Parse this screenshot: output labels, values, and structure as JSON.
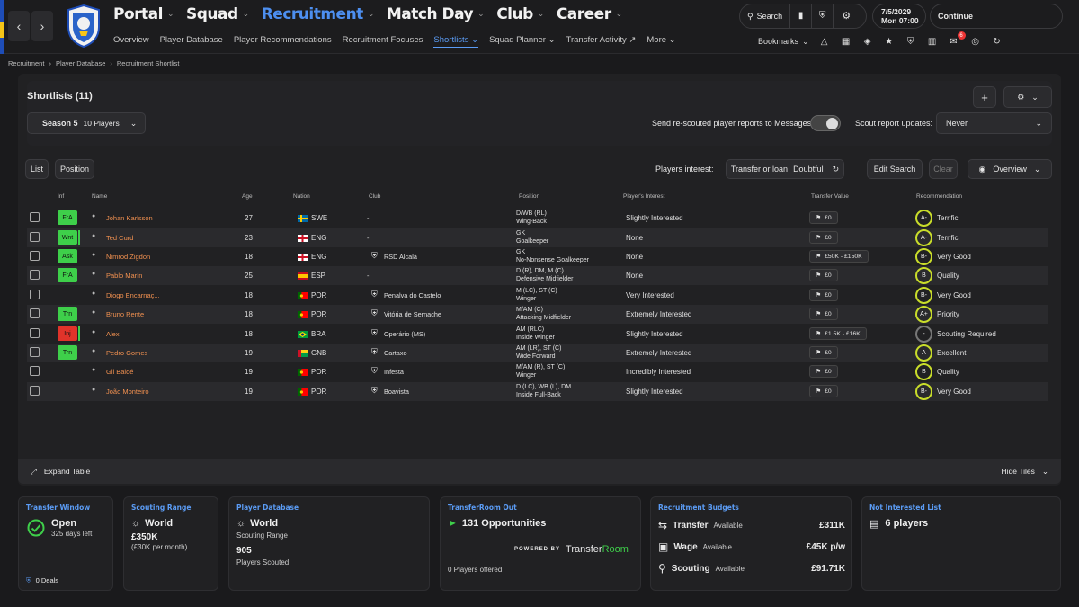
{
  "topnav": {
    "main": [
      {
        "label": "Portal"
      },
      {
        "label": "Squad"
      },
      {
        "label": "Recruitment",
        "active": true
      },
      {
        "label": "Match Day"
      },
      {
        "label": "Club"
      },
      {
        "label": "Career"
      }
    ],
    "sub": [
      "Overview",
      "Player Database",
      "Player Recommendations",
      "Recruitment Focuses",
      "Shortlists",
      "Squad Planner",
      "Transfer Activity",
      "More"
    ],
    "search_label": "Search",
    "date_line1": "7/5/2029",
    "date_line2": "Mon  07:00",
    "continue_label": "Continue",
    "bookmarks_label": "Bookmarks",
    "notif_count": "6"
  },
  "breadcrumb": [
    "Recruitment",
    "Player Database",
    "Recruitment Shortlist"
  ],
  "shortlists": {
    "title": "Shortlists (11)",
    "season_label": "Season 5",
    "season_count": "10 Players",
    "send_reports_label": "Send re-scouted player reports to Messages",
    "scout_updates_label": "Scout report updates:",
    "scout_updates_value": "Never"
  },
  "filters": {
    "list_label": "List",
    "position_label": "Position",
    "interest_label": "Players interest:",
    "interest_value": "Transfer or loan",
    "interest_sub": "Doubtful",
    "edit_search": "Edit Search",
    "clear": "Clear",
    "view": "Overview"
  },
  "columns": [
    "Inf",
    "Name",
    "Age",
    "Nation",
    "Club",
    "Position",
    "Player's Interest",
    "Transfer Value",
    "Recommendation"
  ],
  "rows": [
    {
      "inf": "FrA",
      "inf_color": "#3ecf4a",
      "name": "Johan Karlsson",
      "age": "27",
      "nation": "SWE",
      "flag": "swe",
      "club": "-",
      "pos1": "D/WB (RL)",
      "pos2": "Wing-Back",
      "interest": "Slightly Interested",
      "value": "£0",
      "rec": "A-",
      "rec_text": "Terrific"
    },
    {
      "inf": "Wnt",
      "inf_color": "#3ecf4a",
      "edge": "#3ecf4a",
      "name": "Ted Curd",
      "age": "23",
      "nation": "ENG",
      "flag": "eng",
      "club": "-",
      "pos1": "GK",
      "pos2": "Goalkeeper",
      "interest": "None",
      "value": "£0",
      "rec": "A-",
      "rec_text": "Terrific"
    },
    {
      "inf": "Ask",
      "inf_color": "#3ecf4a",
      "name": "Nimrod Zigdon",
      "age": "18",
      "nation": "ENG",
      "flag": "eng",
      "club": "RSD Alcalá",
      "pos1": "GK",
      "pos2": "No-Nonsense Goalkeeper",
      "interest": "None",
      "value": "£50K - £150K",
      "rec": "B-",
      "rec_text": "Very Good"
    },
    {
      "inf": "FrA",
      "inf_color": "#3ecf4a",
      "name": "Pablo Marín",
      "age": "25",
      "nation": "ESP",
      "flag": "esp",
      "club": "-",
      "pos1": "D (R), DM, M (C)",
      "pos2": "Defensive Midfielder",
      "interest": "None",
      "value": "£0",
      "rec": "B",
      "rec_text": "Quality"
    },
    {
      "inf": "",
      "inf_color": "",
      "name": "Diogo Encarnaç...",
      "age": "18",
      "nation": "POR",
      "flag": "por",
      "club": "Penalva do Castelo",
      "pos1": "M (LC), ST (C)",
      "pos2": "Winger",
      "interest": "Very Interested",
      "value": "£0",
      "rec": "B-",
      "rec_text": "Very Good"
    },
    {
      "inf": "Trn",
      "inf_color": "#3ecf4a",
      "name": "Bruno Rente",
      "age": "18",
      "nation": "POR",
      "flag": "por",
      "club": "Vitória de Sernache",
      "pos1": "M/AM (C)",
      "pos2": "Attacking Midfielder",
      "interest": "Extremely Interested",
      "value": "£0",
      "rec": "A+",
      "rec_text": "Priority"
    },
    {
      "inf": "Inj",
      "inf_color": "#e0332a",
      "edge": "#3ecf4a",
      "name": "Alex",
      "age": "18",
      "nation": "BRA",
      "flag": "bra",
      "club": "Operário (MS)",
      "pos1": "AM (RLC)",
      "pos2": "Inside Winger",
      "interest": "Slightly Interested",
      "value": "£1.5K - £16K",
      "rec": "-",
      "rec_text": "Scouting Required"
    },
    {
      "inf": "Trn",
      "inf_color": "#3ecf4a",
      "name": "Pedro Gomes",
      "age": "19",
      "nation": "GNB",
      "flag": "gnb",
      "club": "Cartaxo",
      "pos1": "AM (LR), ST (C)",
      "pos2": "Wide Forward",
      "interest": "Extremely Interested",
      "value": "£0",
      "rec": "A",
      "rec_text": "Excellent"
    },
    {
      "inf": "",
      "inf_color": "",
      "name": "Gil Baldé",
      "age": "19",
      "nation": "POR",
      "flag": "por",
      "club": "Infesta",
      "pos1": "M/AM (R), ST (C)",
      "pos2": "Winger",
      "interest": "Incredibly Interested",
      "value": "£0",
      "rec": "B",
      "rec_text": "Quality"
    },
    {
      "inf": "",
      "inf_color": "",
      "name": "João Monteiro",
      "age": "19",
      "nation": "POR",
      "flag": "por",
      "club": "Boavista",
      "pos1": "D (LC), WB (L), DM",
      "pos2": "Inside Full-Back",
      "interest": "Slightly Interested",
      "value": "£0",
      "rec": "B-",
      "rec_text": "Very Good"
    }
  ],
  "footer": {
    "expand": "Expand Table",
    "hide": "Hide Tiles"
  },
  "tiles": {
    "transfer_window": {
      "title": "Transfer Window",
      "status": "Open",
      "days": "325 days left",
      "deals": "0 Deals"
    },
    "scouting_range": {
      "title": "Scouting Range",
      "region": "World",
      "amount": "£350K",
      "per_month": "(£30K per month)"
    },
    "player_database": {
      "title": "Player Database",
      "region": "World",
      "region_sub": "Scouting Range",
      "count": "905",
      "count_sub": "Players Scouted"
    },
    "transferroom": {
      "title": "TransferRoom Out",
      "opportunities": "131 Opportunities",
      "powered": "POWERED BY",
      "brand_a": "Transfer",
      "brand_b": "Room",
      "offered": "0 Players offered"
    },
    "budgets": {
      "title": "Recruitment Budgets",
      "transfer_label": "Transfer",
      "transfer_avail": "Available",
      "transfer_val": "£311K",
      "wage_label": "Wage",
      "wage_avail": "Available",
      "wage_val": "£45K p/w",
      "scouting_label": "Scouting",
      "scouting_avail": "Available",
      "scouting_val": "£91.71K"
    },
    "not_interested": {
      "title": "Not Interested List",
      "count": "6 players"
    }
  }
}
